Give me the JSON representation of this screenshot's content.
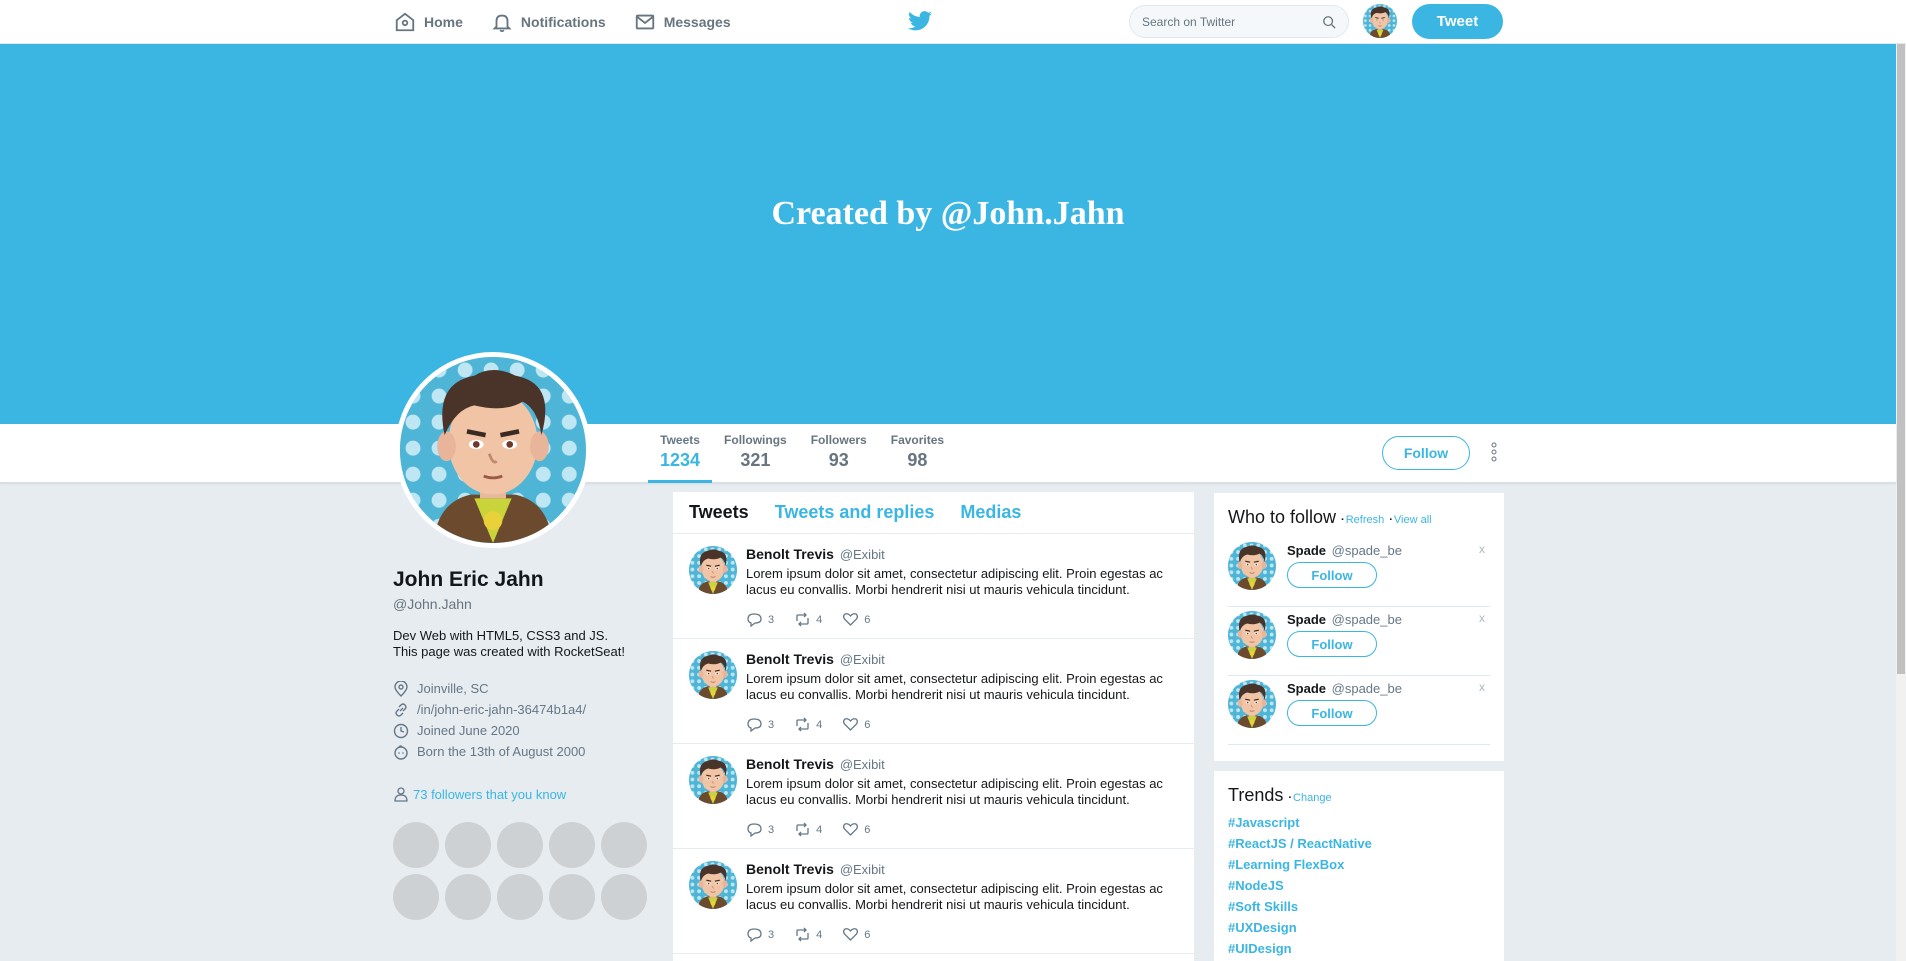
{
  "nav": {
    "home": "Home",
    "notifications": "Notifications",
    "messages": "Messages",
    "search_placeholder": "Search on Twitter",
    "tweet_button": "Tweet"
  },
  "banner": {
    "text": "Created by @John.Jahn"
  },
  "stats": [
    {
      "label": "Tweets",
      "value": "1234"
    },
    {
      "label": "Followings",
      "value": "321"
    },
    {
      "label": "Followers",
      "value": "93"
    },
    {
      "label": "Favorites",
      "value": "98"
    }
  ],
  "follow_button": "Follow",
  "profile": {
    "name": "John Eric Jahn",
    "handle": "@John.Jahn",
    "bio_line1": "Dev Web with HTML5, CSS3 and JS.",
    "bio_line2": "This page was created with RocketSeat!",
    "location": "Joinville, SC",
    "link": "/in/john-eric-jahn-36474b1a4/",
    "joined": "Joined June 2020",
    "born": "Born the 13th of August 2000",
    "followers_you_know": "73 followers that you know"
  },
  "timeline": {
    "tabs": [
      "Tweets",
      "Tweets and replies",
      "Medias"
    ],
    "tweets": [
      {
        "name": "Benolt Trevis",
        "user": "@Exibit",
        "text": "Lorem ipsum dolor sit amet, consectetur adipiscing elit. Proin egestas ac lacus eu convallis. Morbi hendrerit nisi ut mauris vehicula tincidunt.",
        "replies": "3",
        "retweets": "4",
        "likes": "6"
      },
      {
        "name": "Benolt Trevis",
        "user": "@Exibit",
        "text": "Lorem ipsum dolor sit amet, consectetur adipiscing elit. Proin egestas ac lacus eu convallis. Morbi hendrerit nisi ut mauris vehicula tincidunt.",
        "replies": "3",
        "retweets": "4",
        "likes": "6"
      },
      {
        "name": "Benolt Trevis",
        "user": "@Exibit",
        "text": "Lorem ipsum dolor sit amet, consectetur adipiscing elit. Proin egestas ac lacus eu convallis. Morbi hendrerit nisi ut mauris vehicula tincidunt.",
        "replies": "3",
        "retweets": "4",
        "likes": "6"
      },
      {
        "name": "Benolt Trevis",
        "user": "@Exibit",
        "text": "Lorem ipsum dolor sit amet, consectetur adipiscing elit. Proin egestas ac lacus eu convallis. Morbi hendrerit nisi ut mauris vehicula tincidunt.",
        "replies": "3",
        "retweets": "4",
        "likes": "6"
      }
    ]
  },
  "who_to_follow": {
    "title": "Who to follow",
    "refresh": "Refresh",
    "view_all": "View all",
    "suggestions": [
      {
        "name": "Spade",
        "user": "@spade_be",
        "button": "Follow",
        "close": "x"
      },
      {
        "name": "Spade",
        "user": "@spade_be",
        "button": "Follow",
        "close": "x"
      },
      {
        "name": "Spade",
        "user": "@spade_be",
        "button": "Follow",
        "close": "x"
      }
    ]
  },
  "trends": {
    "title": "Trends",
    "change": "Change",
    "items": [
      "#Javascript",
      "#ReactJS / ReactNative",
      "#Learning FlexBox",
      "#NodeJS",
      "#Soft Skills",
      "#UXDesign",
      "#UIDesign"
    ]
  },
  "colors": {
    "accent": "#3bb6e2",
    "background": "#e6ecf0"
  }
}
